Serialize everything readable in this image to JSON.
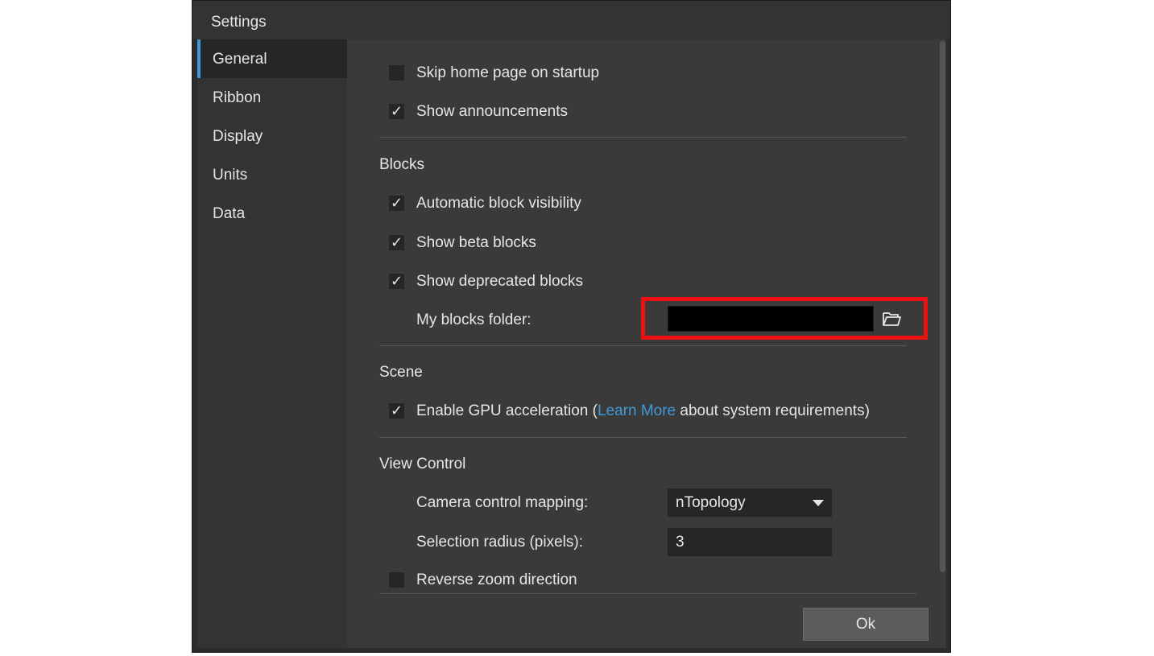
{
  "dialog": {
    "title": "Settings"
  },
  "sidebar": {
    "items": [
      {
        "label": "General"
      },
      {
        "label": "Ribbon"
      },
      {
        "label": "Display"
      },
      {
        "label": "Units"
      },
      {
        "label": "Data"
      }
    ],
    "active_index": 0
  },
  "general": {
    "skip_home": {
      "label": "Skip home page on startup",
      "checked": false
    },
    "show_announcements": {
      "label": "Show announcements",
      "checked": true
    }
  },
  "blocks": {
    "title": "Blocks",
    "auto_visibility": {
      "label": "Automatic block visibility",
      "checked": true
    },
    "beta": {
      "label": "Show beta blocks",
      "checked": true
    },
    "deprecated": {
      "label": "Show deprecated blocks",
      "checked": true
    },
    "folder_label": "My blocks folder:"
  },
  "scene": {
    "title": "Scene",
    "gpu": {
      "prefix": "Enable GPU acceleration (",
      "link": "Learn More",
      "suffix": " about system requirements)",
      "checked": true
    }
  },
  "view_control": {
    "title": "View Control",
    "camera_label": "Camera control mapping:",
    "camera_value": "nTopology",
    "radius_label": "Selection radius (pixels):",
    "radius_value": "3",
    "reverse_zoom": {
      "label": "Reverse zoom direction",
      "checked": false
    }
  },
  "footer": {
    "ok_label": "Ok"
  },
  "checkmark": "✓",
  "colors": {
    "accent": "#3f9ad8",
    "highlight": "#ee1111",
    "background": "#3a3a3a"
  }
}
